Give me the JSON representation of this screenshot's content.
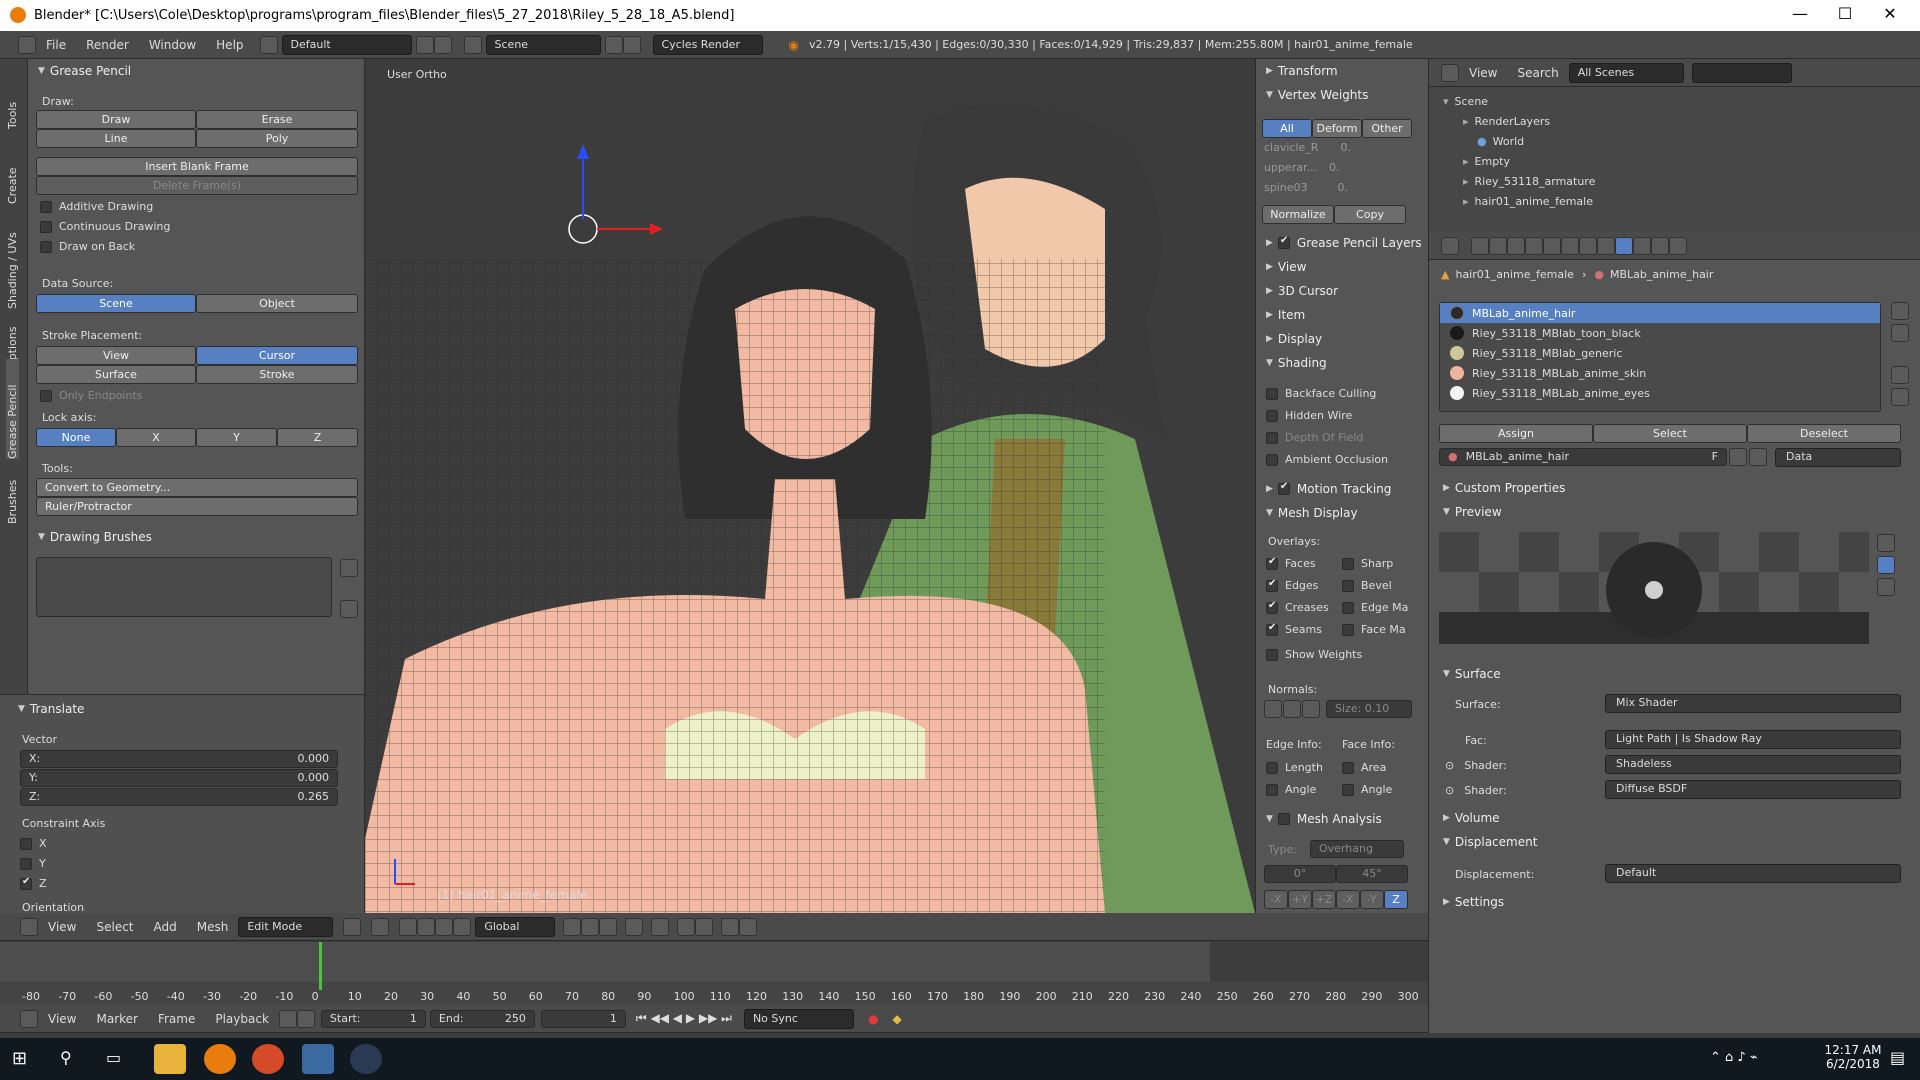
{
  "window": {
    "title": "Blender* [C:\\Users\\Cole\\Desktop\\programs\\program_files\\Blender_files\\5_27_2018\\Riley_5_28_18_A5.blend]",
    "min": "—",
    "max": "☐",
    "close": "✕"
  },
  "info_header": {
    "menus": [
      "File",
      "Render",
      "Window",
      "Help"
    ],
    "layout": "Default",
    "scene": "Scene",
    "engine": "Cycles Render",
    "stats": "v2.79 | Verts:1/15,430 | Edges:0/30,330 | Faces:0/14,929 | Tris:29,837 | Mem:255.80M | hair01_anime_female"
  },
  "grease_pencil": {
    "title": "Grease Pencil",
    "draw_label": "Draw:",
    "draw": "Draw",
    "erase": "Erase",
    "line": "Line",
    "poly": "Poly",
    "insert_blank": "Insert Blank Frame",
    "delete_frames": "Delete Frame(s)",
    "additive": "Additive Drawing",
    "continuous": "Continuous Drawing",
    "draw_on_back": "Draw on Back",
    "data_source_label": "Data Source:",
    "ds_scene": "Scene",
    "ds_object": "Object",
    "stroke_placement_label": "Stroke Placement:",
    "sp_view": "View",
    "sp_cursor": "Cursor",
    "sp_surface": "Surface",
    "sp_stroke": "Stroke",
    "only_endpoints": "Only Endpoints",
    "lock_axis_label": "Lock axis:",
    "lock": [
      "None",
      "X",
      "Y",
      "Z"
    ],
    "tools_label": "Tools:",
    "convert": "Convert to Geometry...",
    "ruler": "Ruler/Protractor",
    "drawing_brushes": "Drawing Brushes"
  },
  "side_tabs": [
    "Tools",
    "Create",
    "Shading / UVs",
    "Options",
    "Grease Pencil",
    "Brushes"
  ],
  "translate": {
    "title": "Translate",
    "vector_label": "Vector",
    "x_label": "X:",
    "x": "0.000",
    "y_label": "Y:",
    "y": "0.000",
    "z_label": "Z:",
    "z": "0.265",
    "constraint_label": "Constraint Axis",
    "cx": "X",
    "cy": "Y",
    "cz": "Z",
    "orientation": "Orientation"
  },
  "viewport": {
    "view_name": "User Ortho",
    "object_label": "(1) hair01_anime_female"
  },
  "view3d_header": {
    "menus": [
      "View",
      "Select",
      "Add",
      "Mesh"
    ],
    "mode": "Edit Mode",
    "orientation": "Global"
  },
  "npanel": {
    "transform": "Transform",
    "vertex_weights": "Vertex Weights",
    "vw_all": "All",
    "vw_deform": "Deform",
    "vw_other": "Other",
    "groups": [
      {
        "name": "clavicle_R",
        "val": "0."
      },
      {
        "name": "upperar...",
        "val": "0."
      },
      {
        "name": "spine03",
        "val": "0."
      }
    ],
    "normalize": "Normalize",
    "copy": "Copy",
    "gp_layers": "Grease Pencil Layers",
    "view": "View",
    "cursor": "3D Cursor",
    "item": "Item",
    "display": "Display",
    "shading": "Shading",
    "backface": "Backface Culling",
    "hidden_wire": "Hidden Wire",
    "dof": "Depth Of Field",
    "ao": "Ambient Occlusion",
    "motion_tracking": "Motion Tracking",
    "mesh_display": "Mesh Display",
    "overlays": "Overlays:",
    "faces": "Faces",
    "sharp": "Sharp",
    "edges": "Edges",
    "bevel": "Bevel",
    "creases": "Creases",
    "edge_ma": "Edge Ma",
    "seams": "Seams",
    "face_ma": "Face Ma",
    "show_weights": "Show Weights",
    "normals": "Normals:",
    "size": "Size: 0.10",
    "edge_info": "Edge Info:",
    "face_info": "Face Info:",
    "length": "Length",
    "area": "Area",
    "angle": "Angle",
    "angle2": "Angle",
    "mesh_analysis": "Mesh Analysis",
    "type_label": "Type:",
    "type": "Overhang",
    "a0": "0°",
    "a45": "45°",
    "axes": [
      "-X",
      "+Y",
      "+Z",
      "-X",
      "-Y",
      "Z"
    ]
  },
  "outliner": {
    "view": "View",
    "search": "Search",
    "all_scenes": "All Scenes",
    "items": [
      {
        "label": "Scene",
        "indent": 0
      },
      {
        "label": "RenderLayers",
        "indent": 1
      },
      {
        "label": "World",
        "indent": 1
      },
      {
        "label": "Empty",
        "indent": 1
      },
      {
        "label": "Riey_53118_armature",
        "indent": 1
      },
      {
        "label": "hair01_anime_female",
        "indent": 1
      }
    ]
  },
  "properties": {
    "crumb1": "hair01_anime_female",
    "crumb2": "MBLab_anime_hair",
    "materials": [
      {
        "name": "MBLab_anime_hair",
        "color": "#2a2a2a"
      },
      {
        "name": "Riey_53118_MBlab_toon_black",
        "color": "#1a1a1a"
      },
      {
        "name": "Riey_53118_MBlab_generic",
        "color": "#cfc79a"
      },
      {
        "name": "Riey_53118_MBLab_anime_skin",
        "color": "#f0b49a"
      },
      {
        "name": "Riey_53118_MBLab_anime_eyes",
        "color": "#f4f4f4"
      }
    ],
    "assign": "Assign",
    "select": "Select",
    "deselect": "Deselect",
    "mat_field": "MBLab_anime_hair",
    "f": "F",
    "data": "Data",
    "custom_props": "Custom Properties",
    "preview": "Preview",
    "surface_section": "Surface",
    "surface_label": "Surface:",
    "surface_val": "Mix Shader",
    "fac_label": "Fac:",
    "fac_val": "Light Path | Is Shadow Ray",
    "shader_label": "Shader:",
    "shader1": "Shadeless",
    "shader_label2": "Shader:",
    "shader2": "Diffuse BSDF",
    "volume": "Volume",
    "displacement_section": "Displacement",
    "displacement_label": "Displacement:",
    "displacement_val": "Default",
    "settings": "Settings"
  },
  "timeline": {
    "ticks": [
      "-80",
      "-70",
      "-60",
      "-50",
      "-40",
      "-30",
      "-20",
      "-10",
      "0",
      "10",
      "20",
      "30",
      "40",
      "50",
      "60",
      "70",
      "80",
      "90",
      "100",
      "110",
      "120",
      "130",
      "140",
      "150",
      "160",
      "170",
      "180",
      "190",
      "200",
      "210",
      "220",
      "230",
      "240",
      "250",
      "260",
      "270",
      "280",
      "290",
      "300"
    ],
    "menus": [
      "View",
      "Marker",
      "Frame",
      "Playback"
    ],
    "start": "Start:",
    "start_val": "1",
    "end": "End:",
    "end_val": "250",
    "frame": "1",
    "sync": "No Sync"
  },
  "taskbar": {
    "time": "12:17 AM",
    "date": "6/2/2018"
  },
  "colors": {
    "selection": "#5680c2",
    "skin": "#f2b9a3",
    "panel": "#555555"
  }
}
